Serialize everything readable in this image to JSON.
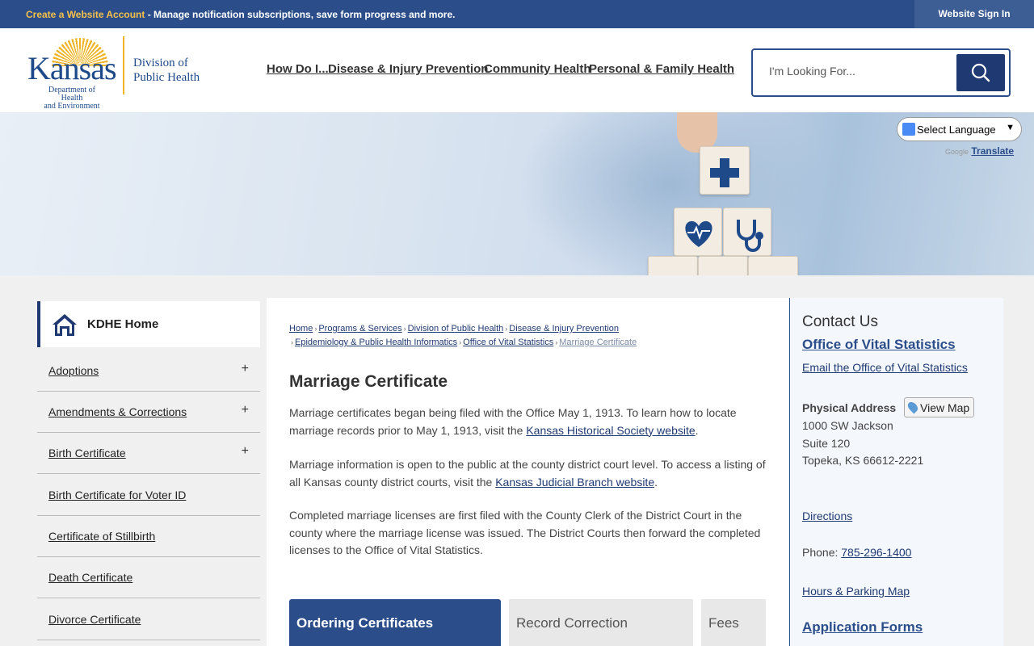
{
  "topbar": {
    "create_account": "Create a Website Account",
    "message": " - Manage notification subscriptions, save form progress and more.",
    "sign_in": "Website Sign In"
  },
  "logo": {
    "wordmark": "Kansas",
    "dept_line1": "Department of Health",
    "dept_line2": "and Environment",
    "division_line1": "Division of",
    "division_line2": "Public Health"
  },
  "nav": {
    "items": [
      "How Do I...",
      "Disease & Injury Prevention",
      "Community Health",
      "Personal & Family Health"
    ]
  },
  "search": {
    "placeholder": "I'm Looking For..."
  },
  "translate": {
    "select_label": "Select Language",
    "powered_by": "Google",
    "translate_link": "Translate"
  },
  "sidebar": {
    "home_label": "KDHE Home",
    "items": [
      {
        "label": "Adoptions",
        "expand": "+"
      },
      {
        "label": "Amendments & Corrections",
        "expand": "+"
      },
      {
        "label": "Birth Certificate",
        "expand": "+"
      },
      {
        "label": "Birth Certificate for Voter ID",
        "expand": ""
      },
      {
        "label": "Certificate of Stillbirth",
        "expand": ""
      },
      {
        "label": "Death Certificate",
        "expand": ""
      },
      {
        "label": "Divorce Certificate",
        "expand": ""
      }
    ]
  },
  "breadcrumb": {
    "items": [
      "Home",
      "Programs & Services",
      "Division of Public Health",
      "Disease & Injury Prevention",
      "Epidemiology & Public Health Informatics",
      "Office of Vital Statistics"
    ],
    "current": "Marriage Certificate"
  },
  "main": {
    "title": "Marriage Certificate",
    "p1_text": "Marriage certificates began being filed with the Office May 1, 1913. To learn how to locate marriage records prior to May 1, 1913, visit the ",
    "p1_link": "Kansas Historical Society website",
    "p2_text": "Marriage information is open to the public at the county district court level. To access a listing of all Kansas county district courts, visit the ",
    "p2_link": "Kansas Judicial Branch website",
    "period": ".",
    "p3_text": "Completed marriage licenses are first filed with the County Clerk of the District Court in the county where the marriage license was issued. The District Courts then forward the completed licenses to the Office of Vital Statistics.",
    "tabs": [
      "Ordering Certificates",
      "Record Correction",
      "Fees"
    ]
  },
  "contact": {
    "heading": "Contact Us",
    "org": "Office of Vital Statistics",
    "email": "Email the Office of Vital Statistics",
    "physical_address_label": "Physical Address",
    "view_map": "View Map",
    "address": [
      "1000 SW Jackson",
      "Suite 120",
      "Topeka, KS 66612-2221"
    ],
    "directions": "Directions",
    "phone_label": "Phone: ",
    "phone": "785-296-1400",
    "hours": "Hours & Parking Map",
    "forms_heading": "Application Forms"
  },
  "colors": {
    "brand_blue": "#2b4e8a",
    "dark_blue": "#1f3a73",
    "gold": "#f0b323"
  }
}
